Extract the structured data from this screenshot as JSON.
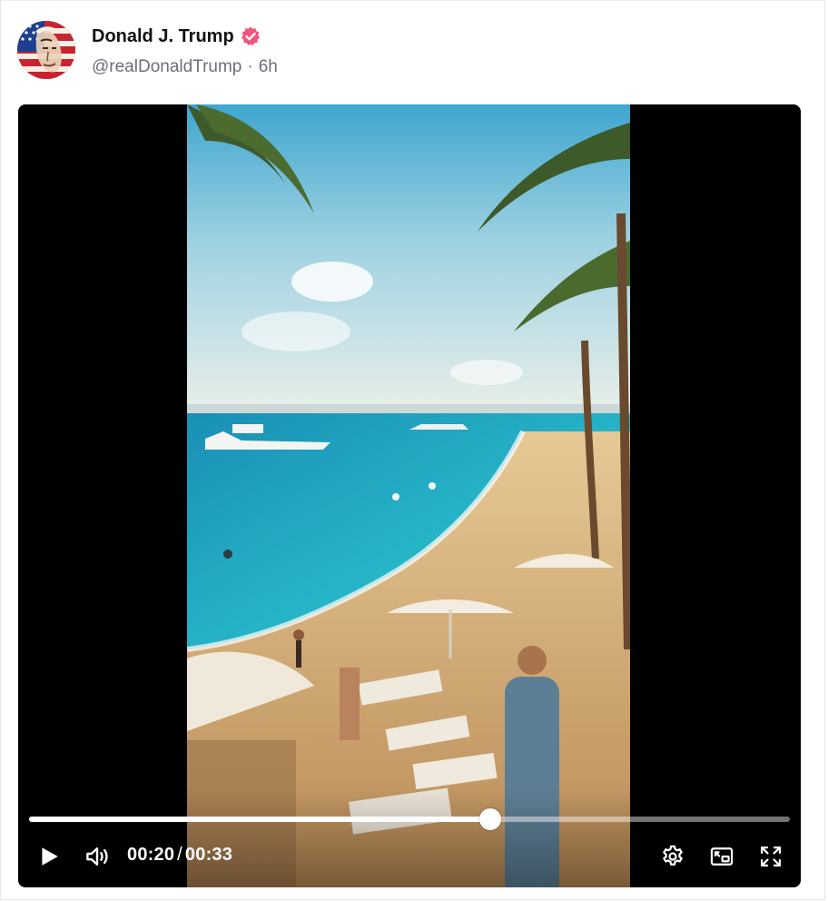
{
  "post": {
    "author": {
      "display_name": "Donald J. Trump",
      "handle": "@realDonaldTrump",
      "separator": "·",
      "time_ago": "6h",
      "verified": true,
      "verified_color": "#f0557e"
    }
  },
  "video": {
    "current_time": "00:20",
    "duration": "00:33",
    "time_separator": "/",
    "progress_fraction": 0.606,
    "state": "paused",
    "icons": {
      "play": "play-icon",
      "volume": "volume-icon",
      "settings": "gear-icon",
      "pip": "picture-in-picture-icon",
      "fullscreen": "fullscreen-icon"
    }
  }
}
